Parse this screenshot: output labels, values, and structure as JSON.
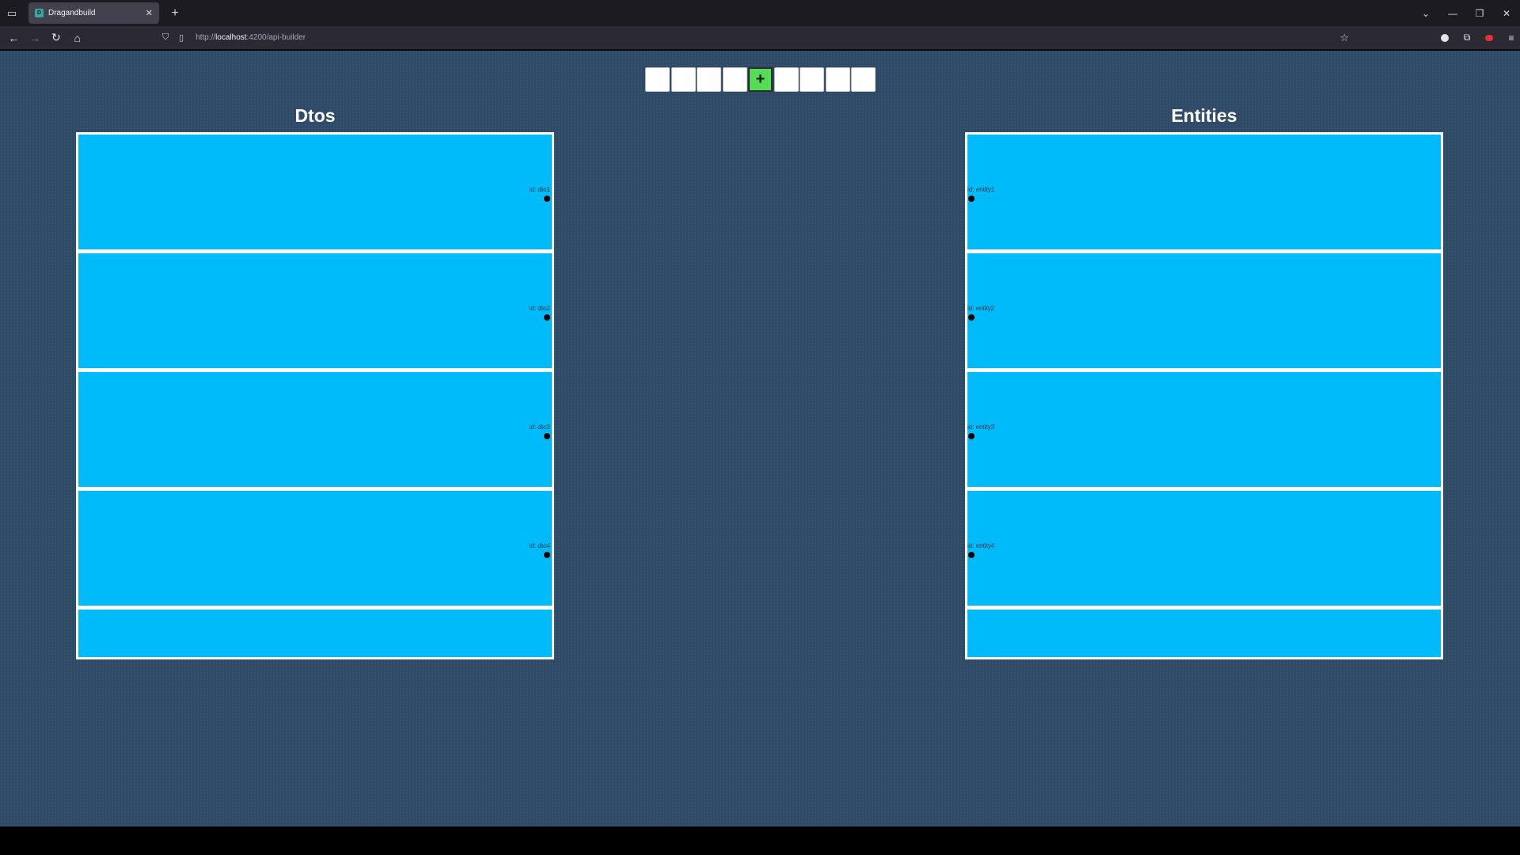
{
  "browser": {
    "tab": {
      "title": "Dragandbuild",
      "favicon_letter": "D"
    },
    "url": {
      "prefix": "http://",
      "host": "localhost",
      "rest": ":4200/api-builder"
    }
  },
  "toolbar": {
    "add_label": "+"
  },
  "dtos": {
    "title": "Dtos",
    "rows": [
      {
        "label": "id: dto1"
      },
      {
        "label": "id: dto2"
      },
      {
        "label": "id: dto3"
      },
      {
        "label": "id: dto4"
      },
      {
        "label": ""
      }
    ]
  },
  "entities": {
    "title": "Entities",
    "rows": [
      {
        "label": "id: entity1"
      },
      {
        "label": "id: entity2"
      },
      {
        "label": "id: entity3"
      },
      {
        "label": "id: entity4"
      },
      {
        "label": ""
      }
    ]
  },
  "colors": {
    "page_bg": "#2e4a66",
    "row_bg": "#00bbf9",
    "add_button": "#55dd55",
    "panel_border": "#ffffff"
  },
  "icons": {
    "tab_list": "tab-list-icon",
    "back": "back-arrow-icon",
    "forward": "forward-arrow-icon",
    "reload": "reload-icon",
    "home": "home-icon",
    "shield": "shield-icon",
    "page": "page-icon",
    "bookmark": "star-icon",
    "account": "account-icon",
    "extensions": "puzzle-icon",
    "addon": "addon-icon",
    "menu": "hamburger-menu-icon"
  }
}
